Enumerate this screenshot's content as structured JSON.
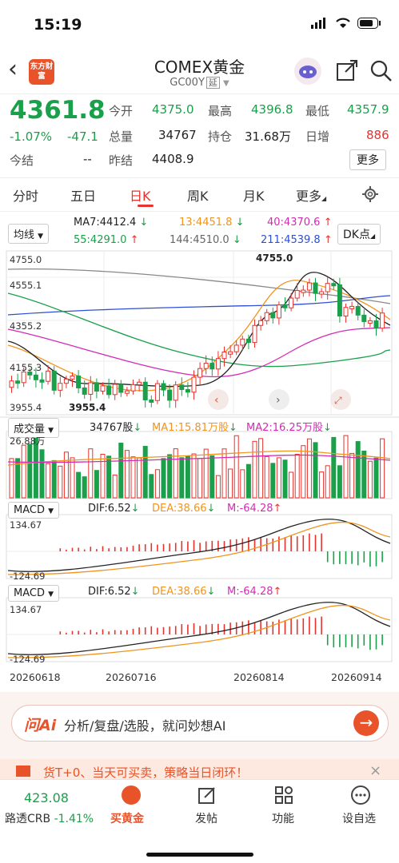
{
  "status": {
    "time": "15:19"
  },
  "header": {
    "logo_text": "东方财富",
    "title": "COMEX黄金",
    "code": "GC00Y",
    "code_tag": "延"
  },
  "quote": {
    "price": "4361.8",
    "change_pct": "-1.07%",
    "change": "-47.1",
    "settle_today_label": "今结",
    "settle_today": "--",
    "fields": {
      "open_label": "今开",
      "open": "4375.0",
      "high_label": "最高",
      "high": "4396.8",
      "low_label": "最低",
      "low": "4357.9",
      "volume_label": "总量",
      "volume": "34767",
      "position_label": "持仓",
      "position": "31.68万",
      "daily_inc_label": "日增",
      "daily_inc": "886",
      "prev_settle_label": "昨结",
      "prev_settle": "4408.9",
      "more": "更多"
    }
  },
  "tabs": [
    "分时",
    "五日",
    "日K",
    "周K",
    "月K",
    "更多"
  ],
  "active_tab": "日K",
  "indicators": {
    "ma_type": "均线",
    "ma7": "MA7:4412.4",
    "ma13": "13:4451.8",
    "ma40": "40:4370.6",
    "ma55": "55:4291.0",
    "ma144": "144:4510.0",
    "ma211": "211:4539.8",
    "dk": "DK点"
  },
  "kline": {
    "y_labels": [
      "4755.0",
      "4555.1",
      "4355.2",
      "4155.3",
      "3955.4"
    ],
    "max_label": "4755.0",
    "min_label": "3955.4"
  },
  "volume": {
    "label": "成交量",
    "total": "34767股",
    "ma1": "MA1:15.81万股",
    "ma2": "MA2:16.25万股",
    "axis_max": "26.88万"
  },
  "macd": [
    {
      "label": "MACD",
      "dif": "DIF:6.52",
      "dea": "DEA:38.66",
      "m": "M:-64.28",
      "top": "134.67",
      "bottom": "-124.69"
    },
    {
      "label": "MACD",
      "dif": "DIF:6.52",
      "dea": "DEA:38.66",
      "m": "M:-64.28",
      "top": "134.67",
      "bottom": "-124.69"
    }
  ],
  "x_dates": [
    "20260618",
    "20260716",
    "20260814",
    "20260914"
  ],
  "ai": {
    "logo": "问Ai",
    "text": "分析/复盘/选股，就问妙想AI"
  },
  "promo": {
    "text": "货T+0、当天可买卖，策略当日闭环！"
  },
  "bottom_nav": {
    "index_value": "423.08",
    "index_label": "路透CRB",
    "index_change": "-1.41%",
    "buy": "买黄金",
    "post": "发帖",
    "func": "功能",
    "watch": "设自选"
  },
  "colors": {
    "up": "#e8322d",
    "down": "#1aa04a",
    "accent": "#e8532a"
  }
}
